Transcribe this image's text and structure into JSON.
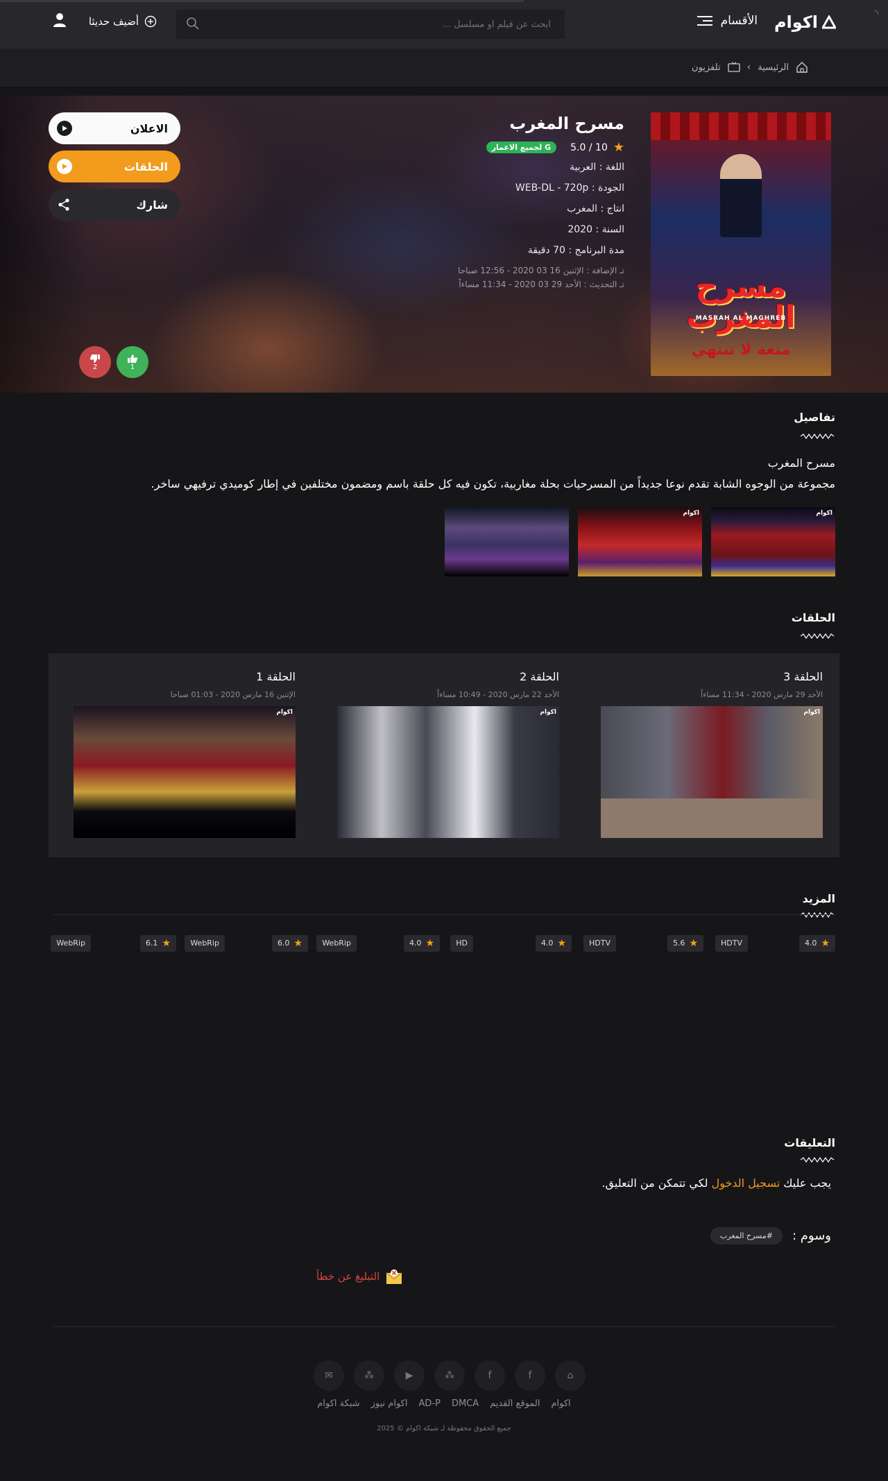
{
  "header": {
    "logo_text": "اكوام",
    "menu_label": "الأقسام",
    "search_placeholder": "ابحث عن فيلم او مسلسل ...",
    "add_recent_label": "أضيف حديثا"
  },
  "breadcrumb": {
    "home": "الرئيسية",
    "section": "تلفزيون"
  },
  "show": {
    "title": "مسرح المغرب",
    "rating_out_of": "10 / 5.0",
    "age_rating": "G لجميع الاعمار",
    "language": "اللغة : العربية",
    "quality": "الجودة : WEB-DL - 720p",
    "production": "انتاج : المغرب",
    "year": "السنة : 2020",
    "duration": "مدة البرنامج : 70 دقيقة",
    "added": "تـ الإضافة : الإثنين 16 03 2020 - 12:56 صباحا",
    "updated": "تـ التحديث : الأحد 29 03 2020 - 11:34 مساءاً",
    "poster": {
      "title": "مسرح المغرب",
      "title_en": "MASRAH AL MAGHREB",
      "tagline": "متعة لا تنتهي"
    }
  },
  "buttons": {
    "trailer": "الاعلان",
    "episodes": "الحلقات",
    "share": "شارك"
  },
  "votes": {
    "likes": "1",
    "dislikes": "2"
  },
  "details": {
    "heading": "تفاصيل",
    "name": "مسرح المغرب",
    "description": "مجموعة من الوجوه الشابة تقدم نوعا جديداً من المسرحيات بحلة مغاربية، تكون فيه كل حلقة باسم ومضمون مختلفين في إطار كوميدي ترفيهي ساخر."
  },
  "episodes": {
    "heading": "الحلقات",
    "watermark": "اكوام",
    "items": [
      {
        "title": "الحلقة 3",
        "date": "الأحد 29 مارس 2020 - 11:34 مساءاً"
      },
      {
        "title": "الحلقة 2",
        "date": "الأحد 22 مارس 2020 - 10:49 مساءاً"
      },
      {
        "title": "الحلقة 1",
        "date": "الإثنين 16 مارس 2020 - 01:03 صباحا"
      }
    ]
  },
  "more": {
    "heading": "المزيد",
    "items": [
      {
        "rating": "4.0",
        "quality": "HDTV"
      },
      {
        "rating": "5.6",
        "quality": "HDTV"
      },
      {
        "rating": "4.0",
        "quality": "HD"
      },
      {
        "rating": "4.0",
        "quality": "WebRip"
      },
      {
        "rating": "6.0",
        "quality": "WebRip"
      },
      {
        "rating": "6.1",
        "quality": "WebRip"
      }
    ]
  },
  "comments": {
    "heading": "التعليقات",
    "prefix": "يجب عليك",
    "login_link": "تسجيل الدخول",
    "suffix": "لكي تتمكن من التعليق."
  },
  "tags": {
    "label": "وسوم :",
    "items": [
      "#مسرح المغرب"
    ]
  },
  "report": {
    "label": "التبليغ عن خطأ"
  },
  "footer": {
    "links": [
      "اكوام",
      "الموقع القديم",
      "DMCA",
      "AD-P",
      "اكوام نيوز",
      "شبكة اكوام"
    ],
    "copyright": "جميع الحقوق محفوظة لـ شبكة اكوام © 2025"
  },
  "colors": {
    "accent": "#f29b1d",
    "background": "#161619",
    "header": "#27272c",
    "like": "#3fb25a",
    "dislike": "#c9474a",
    "age_badge": "#2db356",
    "report": "#d9453d"
  },
  "icons": [
    "logo-icon",
    "menu-icon",
    "search-icon",
    "plus-circle-icon",
    "user-icon",
    "home-icon",
    "tv-icon",
    "chevron-icon",
    "star-icon",
    "play-icon",
    "share-icon",
    "thumbs-up-icon",
    "thumbs-down-icon",
    "report-icon",
    "mail-icon",
    "facebook-icon",
    "youtube-icon",
    "network-icon"
  ]
}
